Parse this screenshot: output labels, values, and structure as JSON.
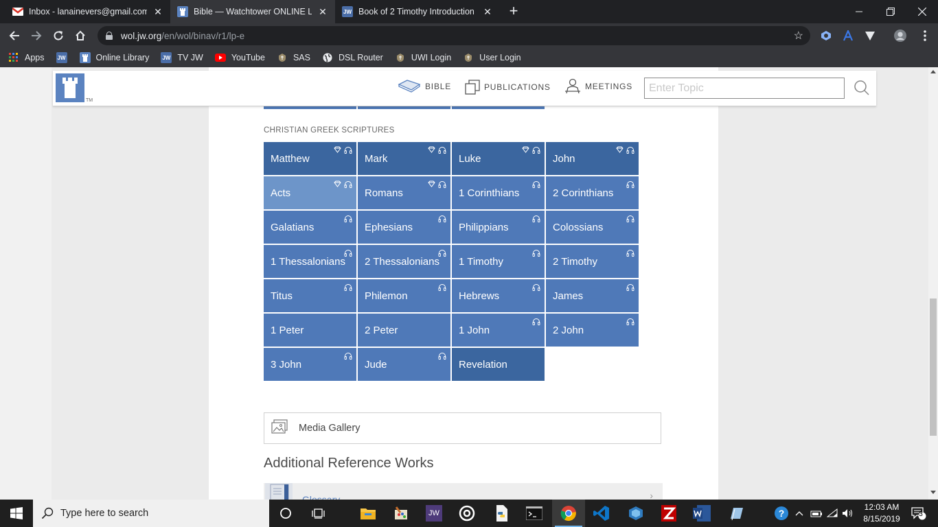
{
  "browser": {
    "tabs": [
      {
        "title": "Inbox - lanainevers@gmail.com -",
        "favicon": "gmail-icon"
      },
      {
        "title": "Bible — Watchtower ONLINE LIB",
        "favicon": "watchtower-icon"
      },
      {
        "title": "Book of 2 Timothy Introduction |",
        "favicon": "jw-icon",
        "favicon_text": "JW"
      }
    ],
    "tab_close": "✕",
    "new_tab": "+",
    "url_domain": "wol.jw.org",
    "url_path": "/en/wol/binav/r1/lp-e",
    "bookmarks": [
      {
        "label": "Apps",
        "icon": "apps-grid-icon"
      },
      {
        "label": "",
        "icon": "jw-icon",
        "icon_text": "JW"
      },
      {
        "label": "Online Library",
        "icon": "watchtower-icon"
      },
      {
        "label": "TV JW",
        "icon": "jw-icon",
        "icon_text": "JW"
      },
      {
        "label": "YouTube",
        "icon": "youtube-icon"
      },
      {
        "label": "SAS",
        "icon": "uwi-crest-icon"
      },
      {
        "label": "DSL Router",
        "icon": "globe-icon"
      },
      {
        "label": "UWI Login",
        "icon": "uwi-crest-icon"
      },
      {
        "label": "User Login",
        "icon": "uwi-crest-icon"
      }
    ]
  },
  "site": {
    "tm": "TM",
    "nav": {
      "bible": "BIBLE",
      "publications": "PUBLICATIONS",
      "meetings": "MEETINGS"
    },
    "search_placeholder": "Enter Topic"
  },
  "section_label": "CHRISTIAN GREEK SCRIPTURES",
  "books": [
    {
      "name": "Matthew",
      "diamond": true,
      "audio": true,
      "shade": "dark"
    },
    {
      "name": "Mark",
      "diamond": true,
      "audio": true,
      "shade": "dark"
    },
    {
      "name": "Luke",
      "diamond": true,
      "audio": true,
      "shade": "dark"
    },
    {
      "name": "John",
      "diamond": true,
      "audio": true,
      "shade": "dark"
    },
    {
      "name": "Acts",
      "diamond": true,
      "audio": true,
      "shade": "light"
    },
    {
      "name": "Romans",
      "diamond": true,
      "audio": true,
      "shade": "normal"
    },
    {
      "name": "1 Corinthians",
      "diamond": false,
      "audio": true,
      "shade": "normal"
    },
    {
      "name": "2 Corinthians",
      "diamond": false,
      "audio": true,
      "shade": "normal"
    },
    {
      "name": "Galatians",
      "diamond": false,
      "audio": true,
      "shade": "normal"
    },
    {
      "name": "Ephesians",
      "diamond": false,
      "audio": true,
      "shade": "normal"
    },
    {
      "name": "Philippians",
      "diamond": false,
      "audio": true,
      "shade": "normal"
    },
    {
      "name": "Colossians",
      "diamond": false,
      "audio": true,
      "shade": "normal"
    },
    {
      "name": "1 Thessalonians",
      "diamond": false,
      "audio": true,
      "shade": "normal"
    },
    {
      "name": "2 Thessalonians",
      "diamond": false,
      "audio": true,
      "shade": "normal"
    },
    {
      "name": "1 Timothy",
      "diamond": false,
      "audio": true,
      "shade": "normal"
    },
    {
      "name": "2 Timothy",
      "diamond": false,
      "audio": true,
      "shade": "normal"
    },
    {
      "name": "Titus",
      "diamond": false,
      "audio": true,
      "shade": "normal"
    },
    {
      "name": "Philemon",
      "diamond": false,
      "audio": true,
      "shade": "normal"
    },
    {
      "name": "Hebrews",
      "diamond": false,
      "audio": true,
      "shade": "normal"
    },
    {
      "name": "James",
      "diamond": false,
      "audio": true,
      "shade": "normal"
    },
    {
      "name": "1 Peter",
      "diamond": false,
      "audio": false,
      "shade": "normal"
    },
    {
      "name": "2 Peter",
      "diamond": false,
      "audio": false,
      "shade": "normal"
    },
    {
      "name": "1 John",
      "diamond": false,
      "audio": true,
      "shade": "normal"
    },
    {
      "name": "2 John",
      "diamond": false,
      "audio": true,
      "shade": "normal"
    },
    {
      "name": "3 John",
      "diamond": false,
      "audio": true,
      "shade": "normal"
    },
    {
      "name": "Jude",
      "diamond": false,
      "audio": true,
      "shade": "normal"
    },
    {
      "name": "Revelation",
      "diamond": false,
      "audio": false,
      "shade": "dark"
    }
  ],
  "media_gallery": "Media Gallery",
  "additional_reference": "Additional Reference Works",
  "glossary": "Glossary",
  "taskbar": {
    "search_placeholder": "Type here to search",
    "apps": [
      "task-view-icon",
      "file-explorer-icon",
      "paint-icon",
      "jw-library-icon",
      "app-circle-icon",
      "python-icon",
      "terminal-icon",
      "chrome-icon",
      "vscode-icon",
      "virtualbox-icon",
      "filezilla-icon",
      "word-icon",
      "notepad-icon"
    ],
    "jw_label": "JW",
    "clock_time": "12:03 AM",
    "clock_date": "8/15/2019",
    "notifications": "3"
  },
  "colors": {
    "tile": "#4f79b8",
    "tile_dark": "#3b669f",
    "tile_light": "#6d95c9",
    "brand_blue": "#5b83c0"
  }
}
